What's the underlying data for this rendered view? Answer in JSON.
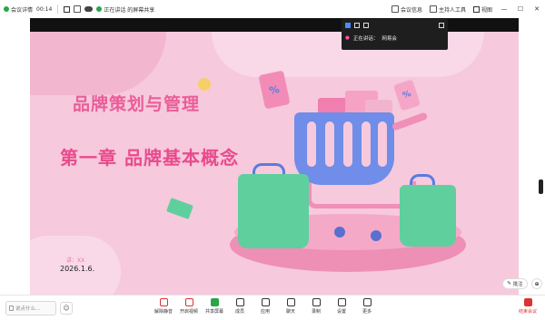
{
  "topbar": {
    "items": [
      {
        "label": "会议详情",
        "icon": "info-icon"
      },
      {
        "label": "00:14",
        "icon": "timer-icon"
      },
      {
        "label": "",
        "icon": "grid-icon"
      },
      {
        "label": "",
        "icon": "screenshot-icon"
      },
      {
        "label": "",
        "icon": "cloud-icon"
      },
      {
        "label": "正在讲话 的屏幕共享",
        "icon": "share-icon"
      }
    ],
    "right": [
      {
        "label": "会议信息",
        "icon": "info-icon"
      },
      {
        "label": "主持人工具",
        "icon": "host-tools-icon"
      },
      {
        "label": "视图",
        "icon": "view-icon"
      }
    ]
  },
  "panel": {
    "row1_icons": [
      "minimize-icon",
      "layout-icon",
      "list-icon"
    ],
    "speaker_label": "正在讲话：",
    "speaker_name": "网易会",
    "expand_icon": "expand-icon"
  },
  "slide": {
    "title1": "品牌策划与管理",
    "title2": "第一章  品牌基本概念",
    "author": "讲：XX",
    "date": "2026.1.6.",
    "tag_symbol": "%"
  },
  "slide_controls": {
    "edit_label": "批注",
    "zoom_icon": "zoom-icon"
  },
  "bottombar": {
    "chat_placeholder": "说点什么...",
    "emoji": "☺",
    "tools": [
      {
        "label": "解除静音",
        "icon": "mic-icon"
      },
      {
        "label": "开启视频",
        "icon": "camera-icon"
      },
      {
        "label": "共享屏幕",
        "icon": "share-screen-icon"
      },
      {
        "label": "成员",
        "icon": "members-icon"
      },
      {
        "label": "应用",
        "icon": "apps-icon"
      },
      {
        "label": "聊天",
        "icon": "chat-icon"
      },
      {
        "label": "录制",
        "icon": "record-icon"
      },
      {
        "label": "设置",
        "icon": "settings-icon"
      },
      {
        "label": "更多",
        "icon": "more-icon"
      }
    ],
    "end_label": "结束会议"
  },
  "colors": {
    "slide_bg": "#f6c9dd",
    "title_pink": "#ea5d98",
    "cart_blue": "#6f8de9",
    "bag_green": "#5fcf9e",
    "end_red": "#dd3333"
  }
}
